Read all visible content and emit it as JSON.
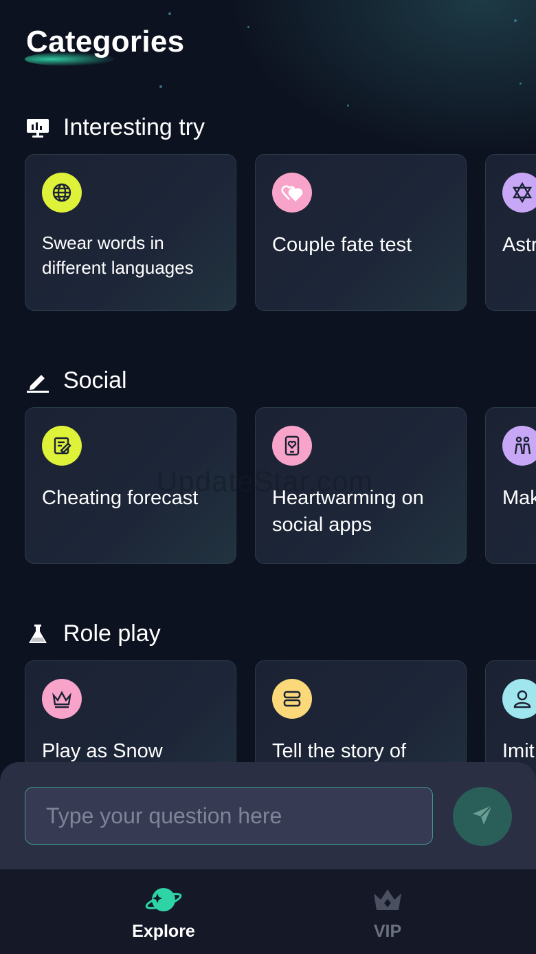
{
  "page": {
    "title": "Categories"
  },
  "watermark": "UpdateStar.com",
  "sections": [
    {
      "title": "Interesting try",
      "icon": "presentation-chart-icon",
      "cards": [
        {
          "title": "Swear words in different languages",
          "icon": "globe-icon",
          "color": "#dff23a"
        },
        {
          "title": "Couple fate test",
          "icon": "hearts-icon",
          "color": "#f8a3c9"
        },
        {
          "title": "Astr",
          "icon": "star-of-david-icon",
          "color": "#c8a8f6"
        }
      ]
    },
    {
      "title": "Social",
      "icon": "pencil-icon",
      "cards": [
        {
          "title": "Cheating forecast",
          "icon": "note-edit-icon",
          "color": "#dff23a"
        },
        {
          "title": "Heartwarming on social apps",
          "icon": "phone-heart-icon",
          "color": "#f8a3c9"
        },
        {
          "title": "Mak hap",
          "icon": "people-icon",
          "color": "#c8a8f6"
        }
      ]
    },
    {
      "title": "Role play",
      "icon": "flask-icon",
      "cards": [
        {
          "title": "Play as Snow",
          "icon": "crown-icon",
          "color": "#f8a3c9"
        },
        {
          "title": "Tell the story of",
          "icon": "stack-icon",
          "color": "#fbd97a"
        },
        {
          "title": "Imit",
          "icon": "person-icon",
          "color": "#9fe6ee"
        }
      ]
    }
  ],
  "input": {
    "placeholder": "Type your question here"
  },
  "nav": [
    {
      "label": "Explore",
      "icon": "planet-icon",
      "active": true
    },
    {
      "label": "VIP",
      "icon": "crown-icon",
      "active": false
    }
  ],
  "colors": {
    "accent": "#2fd4a6",
    "background": "#0d1220",
    "card": "#1d2536",
    "panel": "#2b2f44"
  }
}
